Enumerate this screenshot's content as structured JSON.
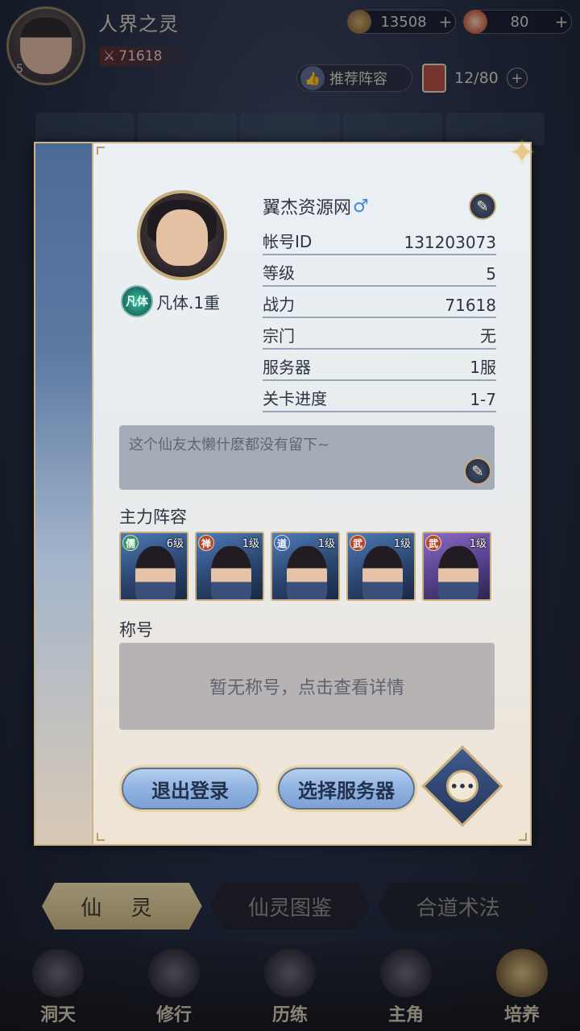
{
  "topbar": {
    "name": "人界之灵",
    "level": "5",
    "power": "71618",
    "currency1": "13508",
    "currency2": "80",
    "plus": "+"
  },
  "toolbar": {
    "recommend_label": "推荐阵容",
    "card_count": "12/80"
  },
  "profile": {
    "nickname": "翼杰资源网",
    "gender_icon": "♂",
    "realm": "凡体.1重",
    "realm_badge": "凡体",
    "rows": [
      {
        "label": "帐号ID",
        "value": "131203073"
      },
      {
        "label": "等级",
        "value": "5"
      },
      {
        "label": "战力",
        "value": "71618"
      },
      {
        "label": "宗门",
        "value": "无"
      },
      {
        "label": "服务器",
        "value": "1服"
      },
      {
        "label": "关卡进度",
        "value": "1-7"
      }
    ],
    "signature": "这个仙友太懒什麽都没有留下~"
  },
  "lineup": {
    "title": "主力阵容",
    "heroes": [
      {
        "class": "儒",
        "level": "6级",
        "color": "green"
      },
      {
        "class": "禅",
        "level": "1级",
        "color": "red"
      },
      {
        "class": "道",
        "level": "1级",
        "color": "blue"
      },
      {
        "class": "武",
        "level": "1级",
        "color": "red"
      },
      {
        "class": "武",
        "level": "1级",
        "color": "red"
      }
    ]
  },
  "honor": {
    "title": "称号",
    "empty_text": "暂无称号，点击查看详情"
  },
  "buttons": {
    "logout": "退出登录",
    "select_server": "选择服务器",
    "more": "•••"
  },
  "tabs": [
    "仙 灵",
    "仙灵图鉴",
    "合道术法"
  ],
  "nav": [
    "洞天",
    "修行",
    "历练",
    "主角",
    "培养"
  ],
  "colors": {
    "button_blue": "#8fb2e0",
    "panel_bg": "#e8ecef",
    "gold_border": "#c9ad7a"
  }
}
